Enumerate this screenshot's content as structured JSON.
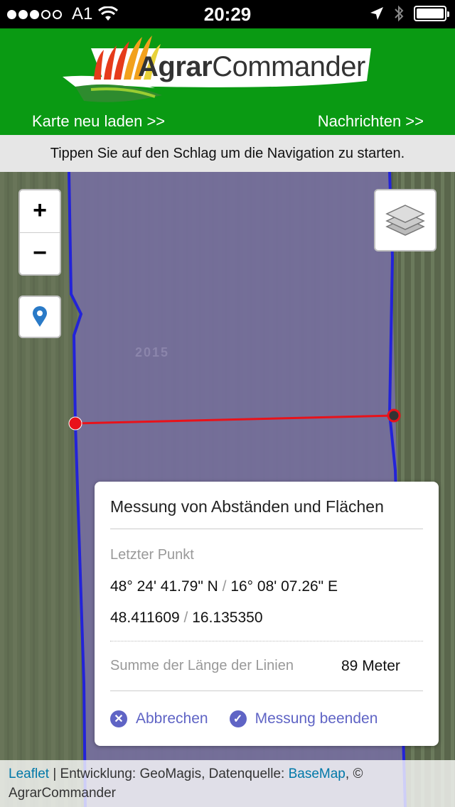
{
  "status_bar": {
    "carrier": "A1",
    "time": "20:29",
    "icons": [
      "signal-dots-icon",
      "wifi-icon",
      "location-arrow-icon",
      "bluetooth-icon",
      "battery-icon"
    ]
  },
  "header": {
    "logo_text_bold": "Agrar",
    "logo_text_light": "Commander",
    "reload_link": "Karte neu laden >>",
    "messages_link": "Nachrichten >>",
    "brand_color": "#0a9a13"
  },
  "info_bar": {
    "text": "Tippen Sie auf den Schlag um die Navigation zu starten."
  },
  "map": {
    "zoom_in": "+",
    "zoom_out": "−",
    "field_label": "2015",
    "controls": [
      "zoom-in-button",
      "zoom-out-button",
      "locate-icon",
      "layers-icon"
    ]
  },
  "measure_panel": {
    "title": "Messung von Abständen und Flächen",
    "last_point_label": "Letzter Punkt",
    "dms_lat": "48° 24' 41.79\" N",
    "dms_sep": " / ",
    "dms_lon": "16° 08' 07.26\" E",
    "dec_lat": "48.411609",
    "dec_sep": " / ",
    "dec_lon": "16.135350",
    "sum_label": "Summe der Länge der Linien",
    "sum_value": "89 Meter",
    "cancel_label": "Abbrechen",
    "finish_label": "Messung beenden",
    "accent_color": "#5f64c5"
  },
  "attribution": {
    "leaflet": "Leaflet",
    "dev_text": " | Entwicklung: GeoMagis, Datenquelle: ",
    "basemap": "BaseMap",
    "tail": ", ©",
    "owner": "AgrarCommander"
  }
}
